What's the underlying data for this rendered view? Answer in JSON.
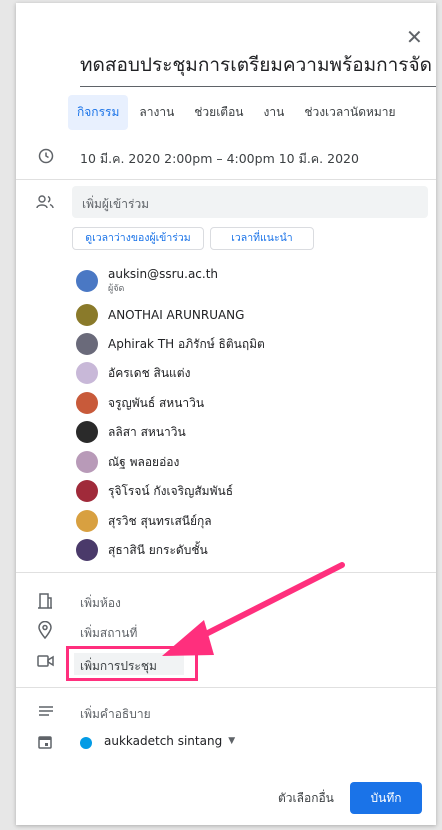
{
  "event": {
    "title": "ทดสอบประชุมการเตรียมความพร้อมการจัด",
    "tabs": [
      "กิจกรรม",
      "ลางาน",
      "ช่วยเตือน",
      "งาน",
      "ช่วงเวลานัดหมาย"
    ],
    "datetime": "10 มี.ค. 2020   2:00pm  –  4:00pm   10 มี.ค. 2020"
  },
  "guests": {
    "input_placeholder": "เพิ่มผู้เข้าร่วม",
    "find_time_label": "ดูเวลาว่างของผู้เข้าร่วม",
    "suggested_times_label": "เวลาที่แนะนำ",
    "list": [
      {
        "name": "auksin@ssru.ac.th",
        "sub": "ผู้จัด",
        "color": "#4a78c4"
      },
      {
        "name": "ANOTHAI ARUNRUANG",
        "sub": "",
        "color": "#8a7a2a"
      },
      {
        "name": "Aphirak TH อภิรักษ์ ธิตินฤมิต",
        "sub": "",
        "color": "#6a6a7a"
      },
      {
        "name": "อัครเดช สินแต่ง",
        "sub": "",
        "color": "#c8b8d8"
      },
      {
        "name": "จรูญพันธ์ สหนาวิน",
        "sub": "",
        "color": "#c85a3a"
      },
      {
        "name": "ลลิสา สหนาวิน",
        "sub": "",
        "color": "#2a2a2a"
      },
      {
        "name": "ณัฐ พลอยอ่อง",
        "sub": "",
        "color": "#b89ab8"
      },
      {
        "name": "รุจิโรจน์ กังเจริญสัมพันธ์",
        "sub": "",
        "color": "#a02a3a"
      },
      {
        "name": "สุรวิช สุนทรเสนีย์กุล",
        "sub": "",
        "color": "#d8a040"
      },
      {
        "name": "สุธาสินี ยกระดับชั้น",
        "sub": "",
        "color": "#4a3a6a"
      }
    ]
  },
  "fields": {
    "room": "เพิ่มห้อง",
    "location": "เพิ่มสถานที่",
    "conference": "เพิ่มการประชุม",
    "description": "เพิ่มคำอธิบาย",
    "calendar_owner": "aukkadetch sintang"
  },
  "footer": {
    "more_options": "ตัวเลือกอื่น",
    "save": "บันทึก"
  },
  "colors": {
    "accent": "#1a73e8",
    "highlight": "#ff2f7d",
    "calendar_dot": "#039be5"
  }
}
